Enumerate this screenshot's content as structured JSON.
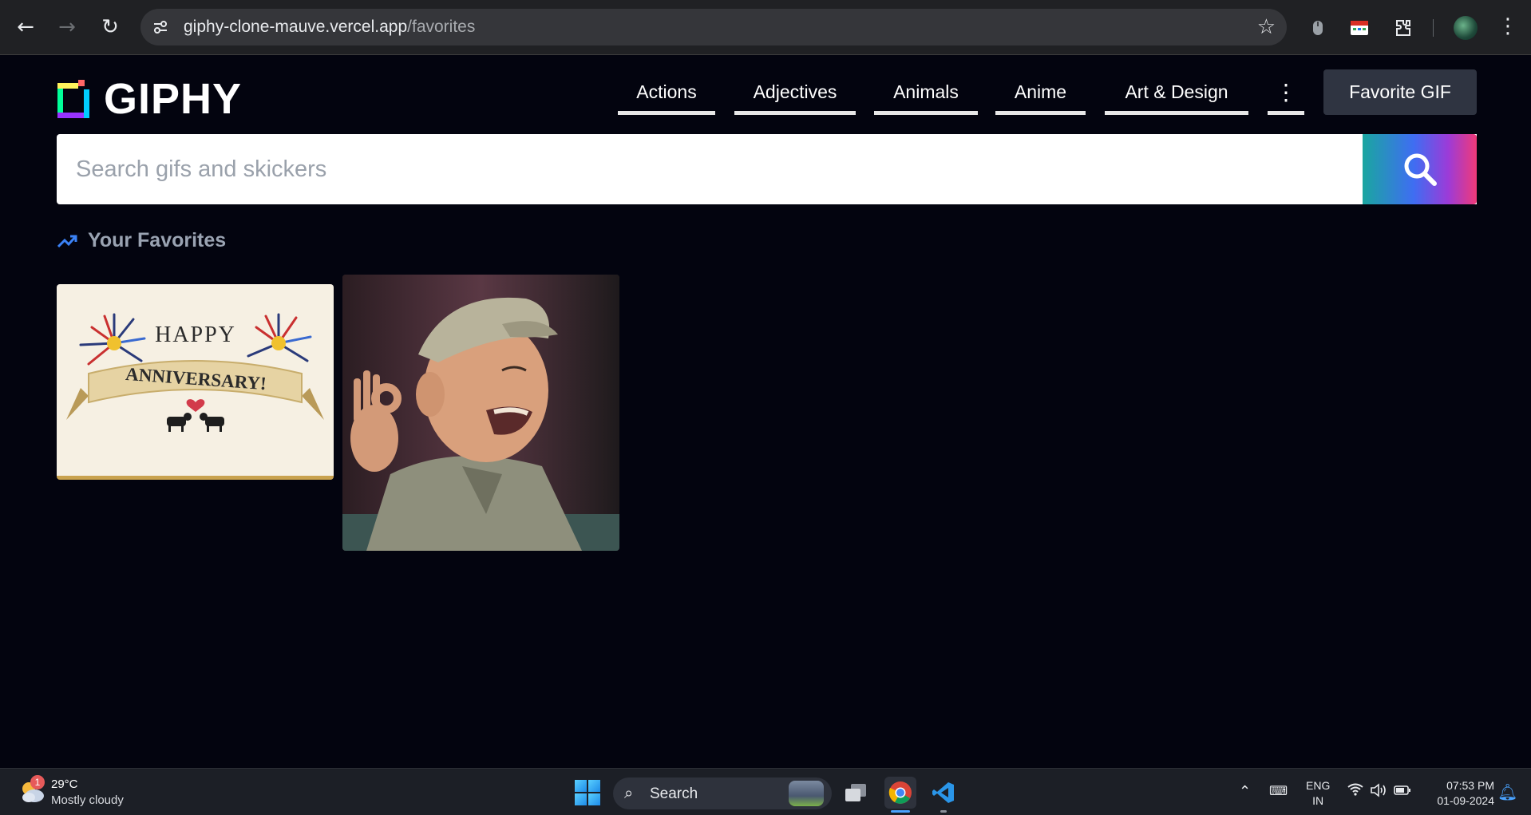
{
  "browser": {
    "url_host": "giphy-clone-mauve.vercel.app",
    "url_path": "/favorites"
  },
  "header": {
    "logo_text": "GIPHY",
    "categories": [
      "Actions",
      "Adjectives",
      "Animals",
      "Anime",
      "Art & Design"
    ],
    "more_icon": "vertical-dots-icon",
    "favorite_button": "Favorite GIF"
  },
  "search": {
    "placeholder": "Search gifs and skickers",
    "icon": "search-icon"
  },
  "favorites": {
    "title": "Your Favorites",
    "icon": "trending-up-icon",
    "gifs": [
      {
        "line1": "HAPPY",
        "line2": "ANNIVERSARY!"
      },
      {
        "line1": "",
        "line2": ""
      }
    ]
  },
  "taskbar": {
    "weather_badge": "1",
    "temperature": "29°C",
    "weather": "Mostly cloudy",
    "search_label": "Search",
    "lang_1": "ENG",
    "lang_2": "IN",
    "time": "07:53 PM",
    "date": "01-09-2024"
  },
  "colors": {
    "page_bg": "#03040f",
    "accent_gradient": [
      "#1aa6a0",
      "#3f6df2",
      "#9c3bd8",
      "#f03a78"
    ],
    "favorite_btn_bg": "#2f3441"
  }
}
